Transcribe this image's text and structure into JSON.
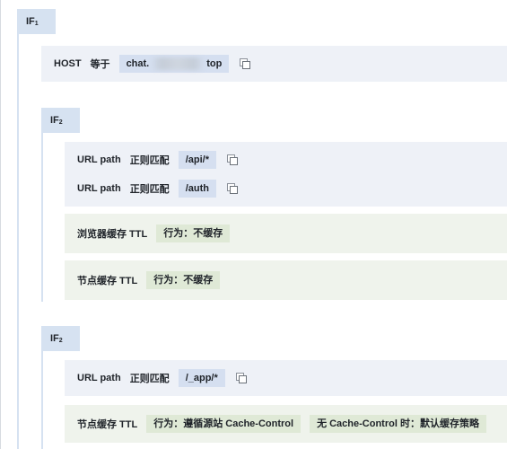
{
  "blocks": {
    "if1": {
      "label": "IF",
      "sub": "1"
    },
    "host": {
      "field": "HOST",
      "op": "等于",
      "value_prefix": "chat.",
      "value_suffix": "top"
    },
    "if2a": {
      "label": "IF",
      "sub": "2"
    },
    "url1": {
      "field": "URL path",
      "op": "正则匹配",
      "value": "/api/*"
    },
    "url2": {
      "field": "URL path",
      "op": "正则匹配",
      "value": "/auth"
    },
    "browser_cache": {
      "field": "浏览器缓存 TTL",
      "action": "行为：不缓存"
    },
    "node_cache_a": {
      "field": "节点缓存 TTL",
      "action": "行为：不缓存"
    },
    "if2b": {
      "label": "IF",
      "sub": "2"
    },
    "url3": {
      "field": "URL path",
      "op": "正则匹配",
      "value": "/_app/*"
    },
    "node_cache_b": {
      "field": "节点缓存 TTL",
      "action": "行为：遵循源站 Cache-Control",
      "extra": "无 Cache-Control 时：默认缓存策略"
    }
  },
  "icons": {
    "copy": "copy-icon"
  },
  "colors": {
    "if_tag": "#d6e2f1",
    "condition_bg": "#eef1f7",
    "action_bg": "#eff3ec",
    "value_blue": "#d5dff0",
    "value_green": "#dfe9d6"
  }
}
